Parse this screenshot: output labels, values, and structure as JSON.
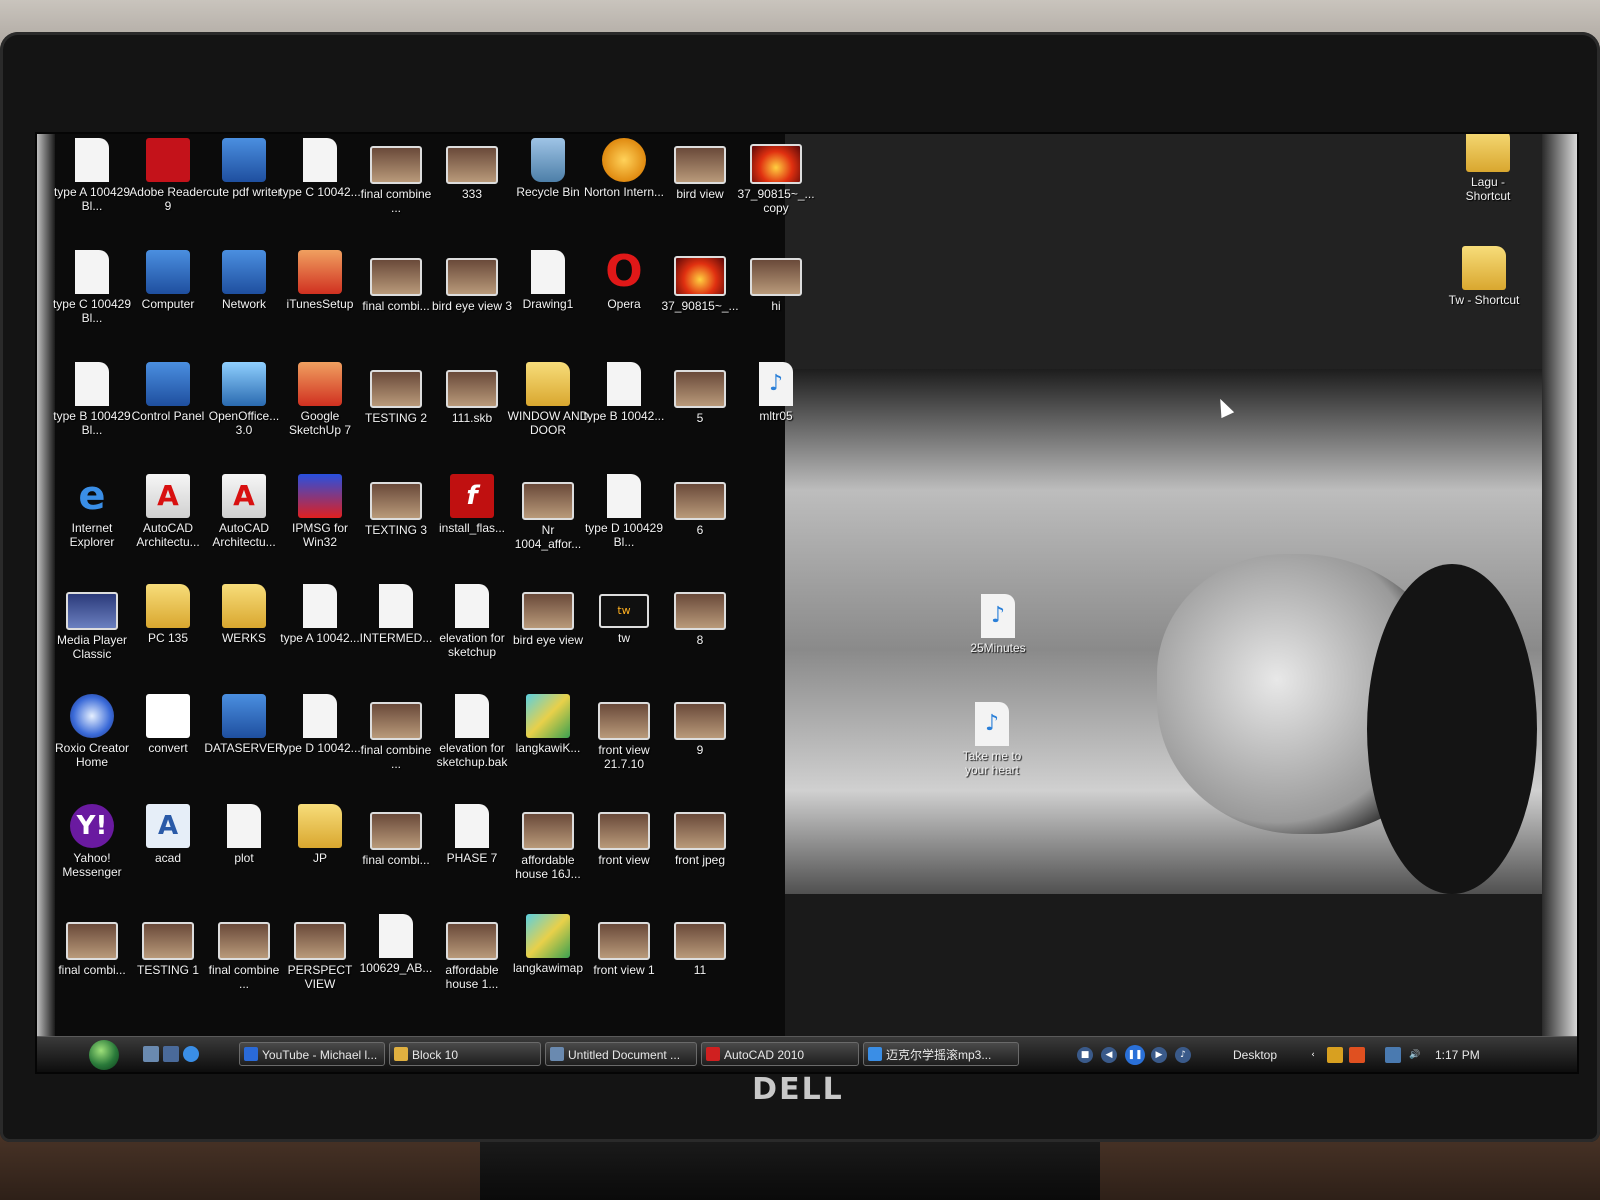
{
  "brand": "DELL",
  "desktop": {
    "left_icons": [
      {
        "label": "type A 100429 Bl...",
        "icon": "document-icon"
      },
      {
        "label": "type C 100429 Bl...",
        "icon": "document-icon"
      },
      {
        "label": "type B 100429 Bl...",
        "icon": "document-icon"
      },
      {
        "label": "Internet Explorer",
        "icon": "ie-icon"
      },
      {
        "label": "Media Player Classic",
        "icon": "media-player-icon"
      },
      {
        "label": "Roxio Creator Home",
        "icon": "disc-icon"
      },
      {
        "label": "Yahoo! Messenger",
        "icon": "yahoo-icon"
      },
      {
        "label": "final combi...",
        "icon": "image-icon"
      },
      {
        "label": "Adobe Reader 9",
        "icon": "pdf-icon"
      },
      {
        "label": "Computer",
        "icon": "computer-icon"
      },
      {
        "label": "Control Panel",
        "icon": "control-panel-icon"
      },
      {
        "label": "AutoCAD Architectu...",
        "icon": "autocad-icon"
      },
      {
        "label": "PC 135",
        "icon": "folder-icon"
      },
      {
        "label": "convert",
        "icon": "convert-icon"
      },
      {
        "label": "acad",
        "icon": "acad-icon"
      },
      {
        "label": "TESTING 1",
        "icon": "image-icon"
      },
      {
        "label": "cute pdf writer",
        "icon": "printer-icon"
      },
      {
        "label": "Network",
        "icon": "network-icon"
      },
      {
        "label": "OpenOffice... 3.0",
        "icon": "openoffice-icon"
      },
      {
        "label": "AutoCAD Architectu...",
        "icon": "autocad-icon"
      },
      {
        "label": "WERKS",
        "icon": "folder-icon"
      },
      {
        "label": "DATASERVER",
        "icon": "computer-icon"
      },
      {
        "label": "plot",
        "icon": "document-icon"
      },
      {
        "label": "final combine ...",
        "icon": "image-icon"
      },
      {
        "label": "type C 10042...",
        "icon": "document-icon"
      },
      {
        "label": "iTunesSetup",
        "icon": "installer-icon"
      },
      {
        "label": "Google SketchUp 7",
        "icon": "sketchup-icon"
      },
      {
        "label": "IPMSG for Win32",
        "icon": "ipmsg-icon"
      },
      {
        "label": "type A 10042...",
        "icon": "document-icon"
      },
      {
        "label": "type D 10042...",
        "icon": "document-icon"
      },
      {
        "label": "JP",
        "icon": "folder-icon"
      },
      {
        "label": "PERSPECT VIEW",
        "icon": "image-icon"
      },
      {
        "label": "final combine ...",
        "icon": "image-icon"
      },
      {
        "label": "final combi...",
        "icon": "image-icon"
      },
      {
        "label": "TESTING 2",
        "icon": "image-icon"
      },
      {
        "label": "TEXTING 3",
        "icon": "image-icon"
      },
      {
        "label": "INTERMED...",
        "icon": "document-icon"
      },
      {
        "label": "final combine ...",
        "icon": "image-icon"
      },
      {
        "label": "final combi...",
        "icon": "image-icon"
      },
      {
        "label": "100629_AB...",
        "icon": "document-icon"
      },
      {
        "label": "333",
        "icon": "image-icon"
      },
      {
        "label": "bird eye view 3",
        "icon": "image-icon"
      },
      {
        "label": "111.skb",
        "icon": "image-icon"
      },
      {
        "label": "install_flas...",
        "icon": "flash-icon"
      },
      {
        "label": "elevation for sketchup",
        "icon": "document-icon"
      },
      {
        "label": "elevation for sketchup.bak",
        "icon": "document-icon"
      },
      {
        "label": "PHASE 7",
        "icon": "document-icon"
      },
      {
        "label": "affordable house 1...",
        "icon": "image-icon"
      },
      {
        "label": "Recycle Bin",
        "icon": "recycle-bin-icon"
      },
      {
        "label": "Drawing1",
        "icon": "document-icon"
      },
      {
        "label": "WINDOW AND DOOR",
        "icon": "folder-icon"
      },
      {
        "label": "Nr 1004_affor...",
        "icon": "image-icon"
      },
      {
        "label": "bird eye view",
        "icon": "image-icon"
      },
      {
        "label": "langkawiK...",
        "icon": "map-icon"
      },
      {
        "label": "affordable house 16J...",
        "icon": "image-icon"
      },
      {
        "label": "langkawimap",
        "icon": "map-icon"
      },
      {
        "label": "Norton Intern...",
        "icon": "norton-icon"
      },
      {
        "label": "Opera",
        "icon": "opera-icon"
      },
      {
        "label": "type B 10042...",
        "icon": "document-icon"
      },
      {
        "label": "type D 100429 Bl...",
        "icon": "document-icon"
      },
      {
        "label": "tw",
        "icon": "tw-icon"
      },
      {
        "label": "front view 21.7.10",
        "icon": "image-icon"
      },
      {
        "label": "front view",
        "icon": "image-icon"
      },
      {
        "label": "front view 1",
        "icon": "image-icon"
      },
      {
        "label": "bird view",
        "icon": "image-icon"
      },
      {
        "label": "37_90815~_...",
        "icon": "sunset-icon"
      },
      {
        "label": "5",
        "icon": "image-icon"
      },
      {
        "label": "6",
        "icon": "image-icon"
      },
      {
        "label": "8",
        "icon": "image-icon"
      },
      {
        "label": "9",
        "icon": "image-icon"
      },
      {
        "label": "front jpeg",
        "icon": "image-icon"
      },
      {
        "label": "11",
        "icon": "image-icon"
      },
      {
        "label": "37_90815~_... copy",
        "icon": "sunset-icon"
      },
      {
        "label": "hi",
        "icon": "image-icon"
      },
      {
        "label": "mltr05",
        "icon": "mp3-icon"
      }
    ],
    "right_icons": [
      {
        "label": "Lagu - Shortcut",
        "icon": "folder-shortcut-icon"
      },
      {
        "label": "Tw - Shortcut",
        "icon": "folder-shortcut-icon"
      },
      {
        "label": "25Minutes",
        "icon": "mp3-icon"
      },
      {
        "label": "Take me to your heart",
        "icon": "mp3-icon"
      }
    ]
  },
  "taskbar": {
    "tasks": [
      {
        "label": "YouTube - Michael l...",
        "color": "#2a6ad8"
      },
      {
        "label": "Block 10",
        "color": "#e0b040"
      },
      {
        "label": "Untitled Document ...",
        "color": "#6a8ab0"
      },
      {
        "label": "AutoCAD 2010",
        "color": "#d02020"
      },
      {
        "label": "迈克尔学摇滚mp3...",
        "color": "#3a8ee6"
      }
    ],
    "toolbar_label": "Desktop",
    "clock": "1:17 PM"
  }
}
